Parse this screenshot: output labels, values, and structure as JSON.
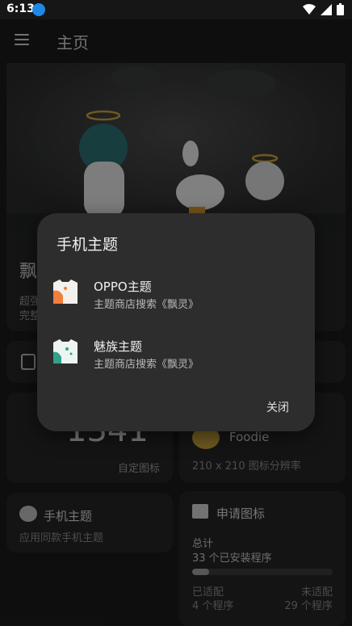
{
  "status_bar": {
    "time": "6:13"
  },
  "app_bar": {
    "title": "主页"
  },
  "hero": {
    "title": "飘",
    "desc_line1": "超强",
    "desc_line2": "完整"
  },
  "stats": {
    "custom_icons_count": "1341",
    "custom_icons_label": "自定图标",
    "foodie_title": "Foodie",
    "foodie_desc": "210 x 210 图标分辨率"
  },
  "theme_card": {
    "title": "手机主题",
    "subtitle": "应用同款手机主题"
  },
  "request_card": {
    "title": "申请图标",
    "total_label": "总计",
    "total_value": "33 个已安装程序",
    "adapted_fraction": 0.12,
    "adapted_label": "已适配",
    "adapted_value": "4 个程序",
    "unadapted_label": "未适配",
    "unadapted_value": "29 个程序"
  },
  "dialog": {
    "title": "手机主题",
    "items": [
      {
        "title": "OPPO主题",
        "subtitle": "主题商店搜索《飘灵》",
        "icon": "shirt-orange-icon",
        "accent": "#f07f3c"
      },
      {
        "title": "魅族主题",
        "subtitle": "主题商店搜索《飘灵》",
        "icon": "shirt-teal-icon",
        "accent": "#2fa38a"
      }
    ],
    "close_label": "关闭"
  }
}
